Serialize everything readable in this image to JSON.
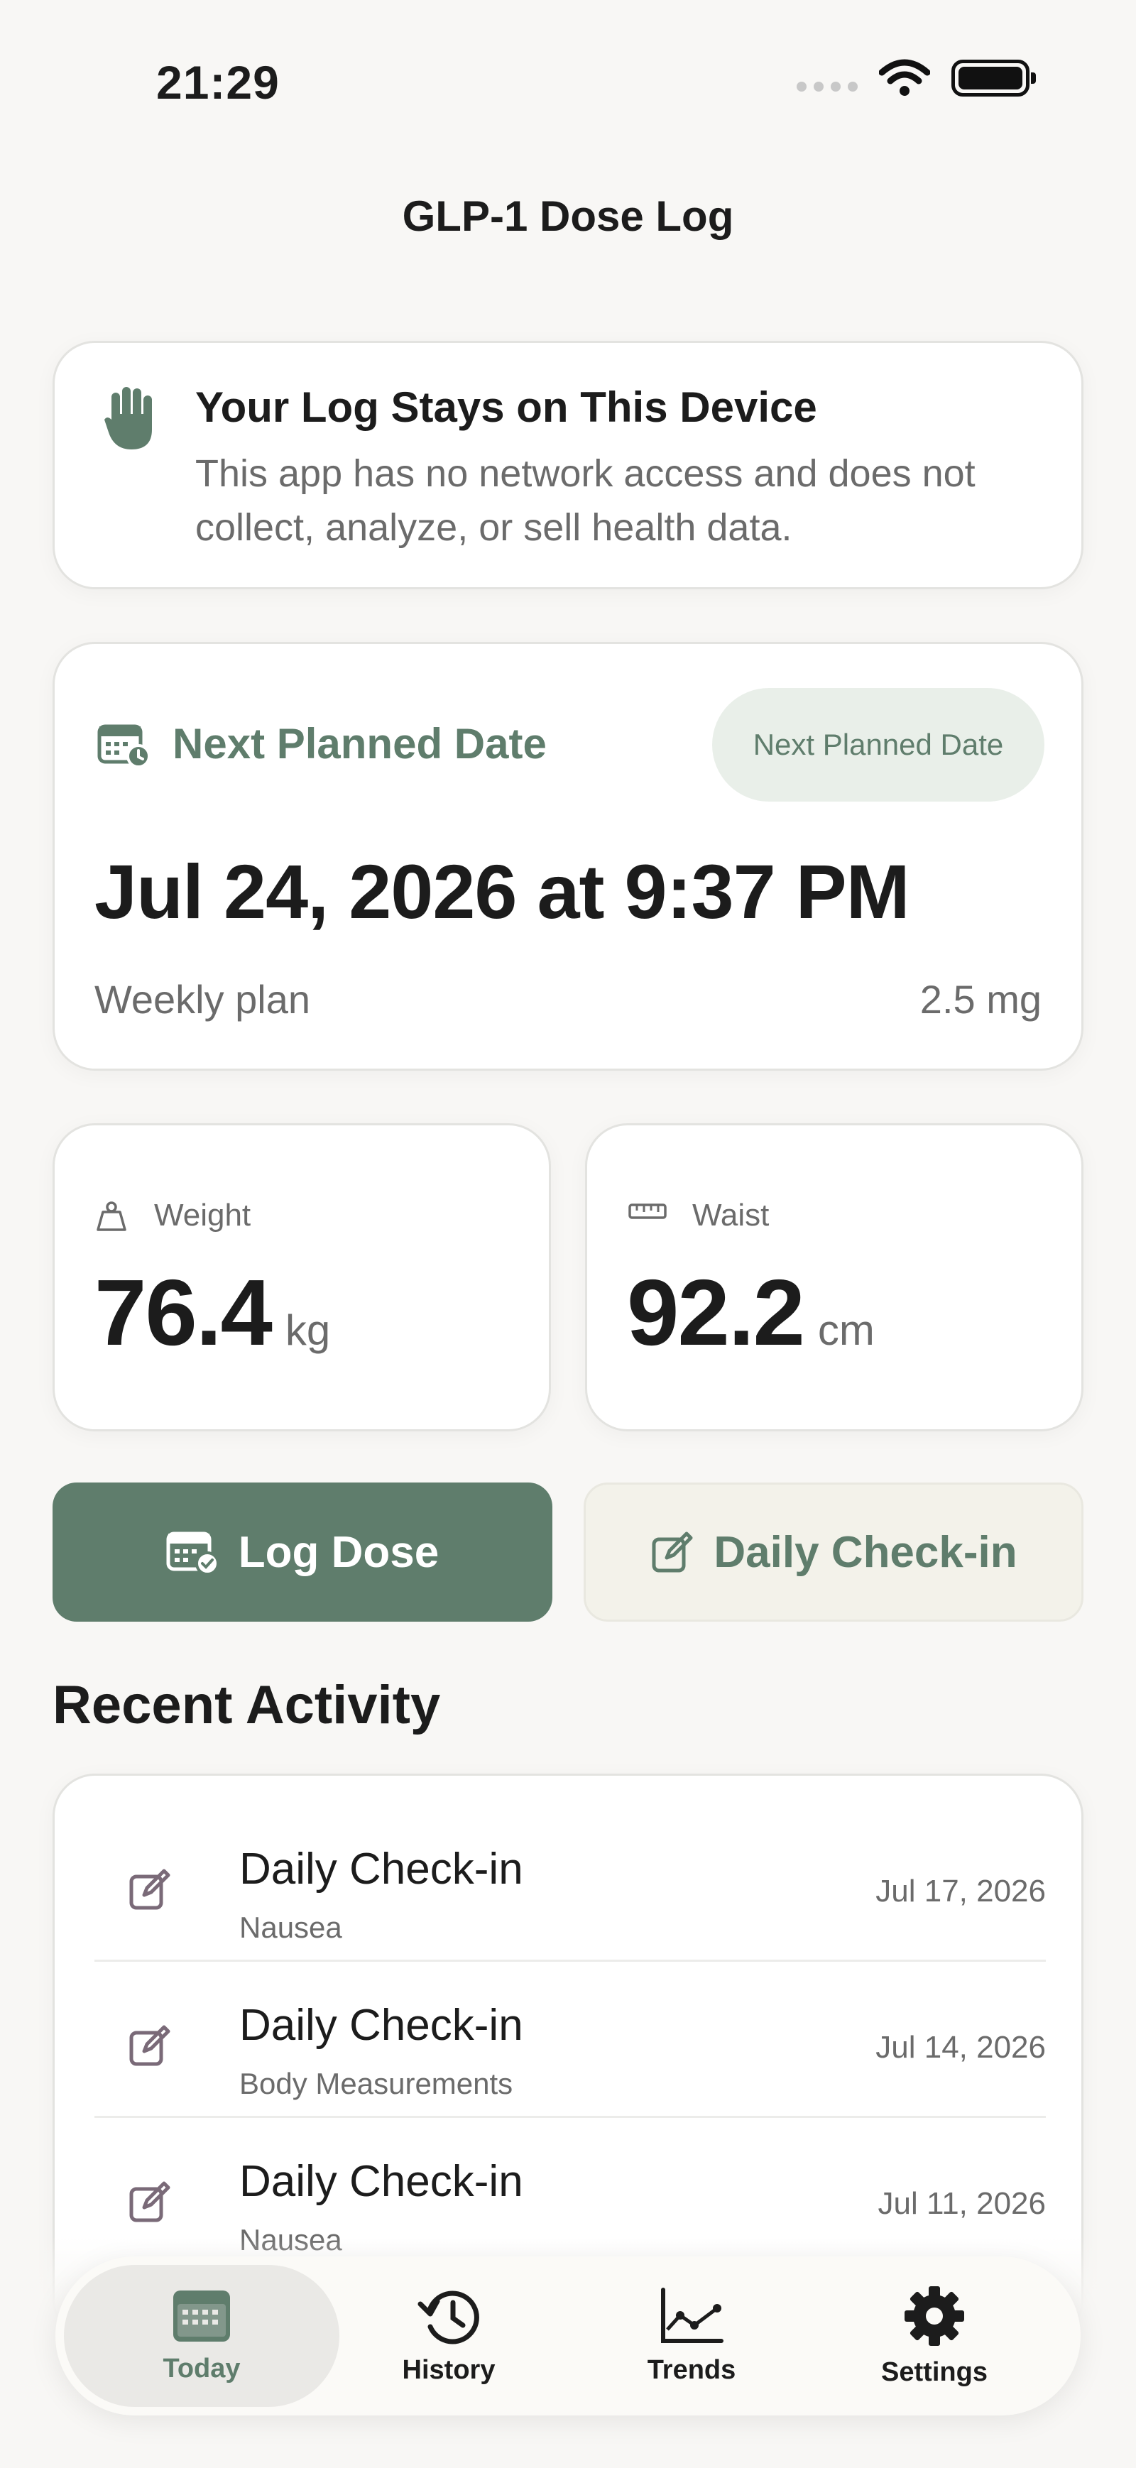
{
  "status_bar": {
    "time": "21:29"
  },
  "nav": {
    "title": "GLP-1 Dose Log"
  },
  "privacy": {
    "title": "Your Log Stays on This Device",
    "body": "This app has no network access and does not collect, analyze, or sell health data."
  },
  "next_plan": {
    "label": "Next Planned Date",
    "badge": "Next Planned Date",
    "datetime": "Jul 24, 2026 at 9:37 PM",
    "frequency": "Weekly plan",
    "dose": "2.5 mg"
  },
  "stats": {
    "weight": {
      "label": "Weight",
      "value": "76.4",
      "unit": "kg"
    },
    "waist": {
      "label": "Waist",
      "value": "92.2",
      "unit": "cm"
    }
  },
  "actions": {
    "log_dose": "Log Dose",
    "daily_checkin": "Daily Check-in"
  },
  "recent": {
    "title": "Recent Activity",
    "items": [
      {
        "title": "Daily Check-in",
        "subtitle": "Nausea",
        "date": "Jul 17, 2026"
      },
      {
        "title": "Daily Check-in",
        "subtitle": "Body Measurements",
        "date": "Jul 14, 2026"
      },
      {
        "title": "Daily Check-in",
        "subtitle": "Nausea",
        "date": "Jul 11, 2026"
      }
    ]
  },
  "tabs": [
    {
      "label": "Today",
      "icon": "calendar-icon",
      "active": true
    },
    {
      "label": "History",
      "icon": "history-icon",
      "active": false
    },
    {
      "label": "Trends",
      "icon": "chart-line-icon",
      "active": false
    },
    {
      "label": "Settings",
      "icon": "gear-icon",
      "active": false
    }
  ],
  "colors": {
    "accent": "#5f7d6c",
    "checkin_icon": "#7a6a78",
    "background": "#f8f7f5"
  }
}
